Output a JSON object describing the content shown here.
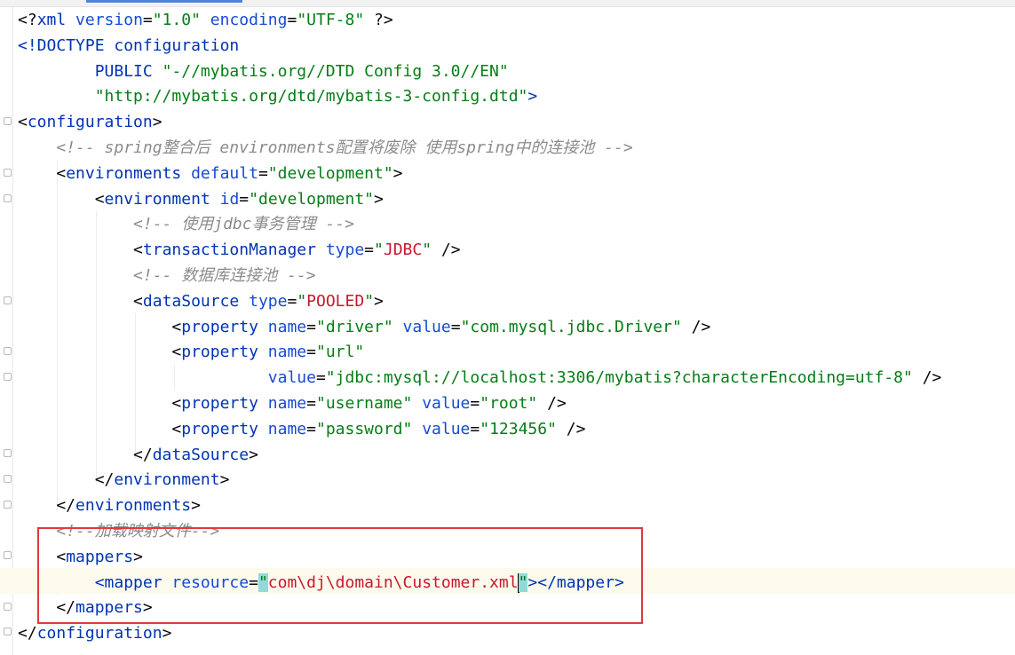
{
  "editor": {
    "lines": [
      {
        "id": "l1",
        "segments": [
          {
            "cls": "t-brk",
            "text": "<?"
          },
          {
            "cls": "t-tag",
            "text": "xml"
          },
          {
            "cls": "t-brk",
            "text": " "
          },
          {
            "cls": "t-attr",
            "text": "version"
          },
          {
            "cls": "t-brk",
            "text": "="
          },
          {
            "cls": "t-val",
            "text": "\"1.0\""
          },
          {
            "cls": "t-brk",
            "text": " "
          },
          {
            "cls": "t-attr",
            "text": "encoding"
          },
          {
            "cls": "t-brk",
            "text": "="
          },
          {
            "cls": "t-val",
            "text": "\"UTF-8\""
          },
          {
            "cls": "t-brk",
            "text": " ?>"
          }
        ]
      },
      {
        "id": "l2",
        "segments": [
          {
            "cls": "t-tag",
            "text": "<!DOCTYPE configuration"
          }
        ]
      },
      {
        "id": "l3",
        "segments": [
          {
            "cls": "t-brk",
            "text": "        "
          },
          {
            "cls": "t-tag",
            "text": "PUBLIC "
          },
          {
            "cls": "t-val",
            "text": "\"-//mybatis.org//DTD Config 3.0//EN\""
          }
        ]
      },
      {
        "id": "l4",
        "segments": [
          {
            "cls": "t-brk",
            "text": "        "
          },
          {
            "cls": "t-val",
            "text": "\"http://mybatis.org/dtd/mybatis-3-config.dtd\""
          },
          {
            "cls": "t-tag",
            "text": ">"
          }
        ]
      },
      {
        "id": "l5",
        "segments": [
          {
            "cls": "t-brk",
            "text": "<"
          },
          {
            "cls": "t-tag",
            "text": "configuration"
          },
          {
            "cls": "t-brk",
            "text": ">"
          }
        ]
      },
      {
        "id": "l6",
        "segments": [
          {
            "cls": "t-brk",
            "text": "    "
          },
          {
            "cls": "t-cmt",
            "text": "<!-- spring整合后 environments配置将废除 使用spring中的连接池 -->"
          }
        ]
      },
      {
        "id": "l7",
        "segments": [
          {
            "cls": "t-brk",
            "text": "    <"
          },
          {
            "cls": "t-tag",
            "text": "environments"
          },
          {
            "cls": "t-brk",
            "text": " "
          },
          {
            "cls": "t-attr",
            "text": "default"
          },
          {
            "cls": "t-brk",
            "text": "="
          },
          {
            "cls": "t-val",
            "text": "\"development\""
          },
          {
            "cls": "t-brk",
            "text": ">"
          }
        ]
      },
      {
        "id": "l8",
        "segments": [
          {
            "cls": "t-brk",
            "text": "        <"
          },
          {
            "cls": "t-tag",
            "text": "environment"
          },
          {
            "cls": "t-brk",
            "text": " "
          },
          {
            "cls": "t-attr",
            "text": "id"
          },
          {
            "cls": "t-brk",
            "text": "="
          },
          {
            "cls": "t-val",
            "text": "\"development\""
          },
          {
            "cls": "t-brk",
            "text": ">"
          }
        ]
      },
      {
        "id": "l9",
        "segments": [
          {
            "cls": "t-brk",
            "text": "            "
          },
          {
            "cls": "t-cmt",
            "text": "<!-- 使用jdbc事务管理 -->"
          }
        ]
      },
      {
        "id": "l10",
        "segments": [
          {
            "cls": "t-brk",
            "text": "            <"
          },
          {
            "cls": "t-tag",
            "text": "transactionManager"
          },
          {
            "cls": "t-brk",
            "text": " "
          },
          {
            "cls": "t-attr",
            "text": "type"
          },
          {
            "cls": "t-brk",
            "text": "="
          },
          {
            "cls": "t-val",
            "text": "\""
          },
          {
            "cls": "t-hl",
            "text": "JDBC"
          },
          {
            "cls": "t-val",
            "text": "\""
          },
          {
            "cls": "t-brk",
            "text": " />"
          }
        ]
      },
      {
        "id": "l11",
        "segments": [
          {
            "cls": "t-brk",
            "text": "            "
          },
          {
            "cls": "t-cmt",
            "text": "<!-- 数据库连接池 -->"
          }
        ]
      },
      {
        "id": "l12",
        "segments": [
          {
            "cls": "t-brk",
            "text": "            <"
          },
          {
            "cls": "t-tag",
            "text": "dataSource"
          },
          {
            "cls": "t-brk",
            "text": " "
          },
          {
            "cls": "t-attr",
            "text": "type"
          },
          {
            "cls": "t-brk",
            "text": "="
          },
          {
            "cls": "t-val",
            "text": "\""
          },
          {
            "cls": "t-hl",
            "text": "POOLED"
          },
          {
            "cls": "t-val",
            "text": "\""
          },
          {
            "cls": "t-brk",
            "text": ">"
          }
        ]
      },
      {
        "id": "l13",
        "segments": [
          {
            "cls": "t-brk",
            "text": "                <"
          },
          {
            "cls": "t-tag",
            "text": "property"
          },
          {
            "cls": "t-brk",
            "text": " "
          },
          {
            "cls": "t-attr",
            "text": "name"
          },
          {
            "cls": "t-brk",
            "text": "="
          },
          {
            "cls": "t-val",
            "text": "\"driver\""
          },
          {
            "cls": "t-brk",
            "text": " "
          },
          {
            "cls": "t-attr",
            "text": "value"
          },
          {
            "cls": "t-brk",
            "text": "="
          },
          {
            "cls": "t-val",
            "text": "\"com.mysql.jdbc.Driver\""
          },
          {
            "cls": "t-brk",
            "text": " />"
          }
        ]
      },
      {
        "id": "l14",
        "segments": [
          {
            "cls": "t-brk",
            "text": "                <"
          },
          {
            "cls": "t-tag",
            "text": "property"
          },
          {
            "cls": "t-brk",
            "text": " "
          },
          {
            "cls": "t-attr",
            "text": "name"
          },
          {
            "cls": "t-brk",
            "text": "="
          },
          {
            "cls": "t-val",
            "text": "\"url\""
          }
        ]
      },
      {
        "id": "l15",
        "segments": [
          {
            "cls": "t-brk",
            "text": "                          "
          },
          {
            "cls": "t-attr",
            "text": "value"
          },
          {
            "cls": "t-brk",
            "text": "="
          },
          {
            "cls": "t-val",
            "text": "\"jdbc:mysql://localhost:3306/mybatis?characterEncoding=utf-8\""
          },
          {
            "cls": "t-brk",
            "text": " />"
          }
        ]
      },
      {
        "id": "l16",
        "segments": [
          {
            "cls": "t-brk",
            "text": "                <"
          },
          {
            "cls": "t-tag",
            "text": "property"
          },
          {
            "cls": "t-brk",
            "text": " "
          },
          {
            "cls": "t-attr",
            "text": "name"
          },
          {
            "cls": "t-brk",
            "text": "="
          },
          {
            "cls": "t-val",
            "text": "\"username\""
          },
          {
            "cls": "t-brk",
            "text": " "
          },
          {
            "cls": "t-attr",
            "text": "value"
          },
          {
            "cls": "t-brk",
            "text": "="
          },
          {
            "cls": "t-val",
            "text": "\"root\""
          },
          {
            "cls": "t-brk",
            "text": " />"
          }
        ]
      },
      {
        "id": "l17",
        "segments": [
          {
            "cls": "t-brk",
            "text": "                <"
          },
          {
            "cls": "t-tag",
            "text": "property"
          },
          {
            "cls": "t-brk",
            "text": " "
          },
          {
            "cls": "t-attr",
            "text": "name"
          },
          {
            "cls": "t-brk",
            "text": "="
          },
          {
            "cls": "t-val",
            "text": "\"password\""
          },
          {
            "cls": "t-brk",
            "text": " "
          },
          {
            "cls": "t-attr",
            "text": "value"
          },
          {
            "cls": "t-brk",
            "text": "="
          },
          {
            "cls": "t-val",
            "text": "\"123456\""
          },
          {
            "cls": "t-brk",
            "text": " />"
          }
        ]
      },
      {
        "id": "l18",
        "segments": [
          {
            "cls": "t-brk",
            "text": "            </"
          },
          {
            "cls": "t-tag",
            "text": "dataSource"
          },
          {
            "cls": "t-brk",
            "text": ">"
          }
        ]
      },
      {
        "id": "l19",
        "segments": [
          {
            "cls": "t-brk",
            "text": "        </"
          },
          {
            "cls": "t-tag",
            "text": "environment"
          },
          {
            "cls": "t-brk",
            "text": ">"
          }
        ]
      },
      {
        "id": "l20",
        "segments": [
          {
            "cls": "t-brk",
            "text": "    </"
          },
          {
            "cls": "t-tag",
            "text": "environments"
          },
          {
            "cls": "t-brk",
            "text": ">"
          }
        ]
      },
      {
        "id": "l21",
        "segments": [
          {
            "cls": "t-brk",
            "text": "    "
          },
          {
            "cls": "t-cmt",
            "text": "<!--加载映射文件-->"
          }
        ]
      },
      {
        "id": "l22",
        "segments": [
          {
            "cls": "t-brk",
            "text": "    <"
          },
          {
            "cls": "t-tag",
            "text": "mappers"
          },
          {
            "cls": "t-brk",
            "text": ">"
          }
        ]
      },
      {
        "id": "l23",
        "segments": [
          {
            "cls": "t-brk",
            "text": "        "
          },
          {
            "cls": "t-tag",
            "text": "<mapper"
          },
          {
            "cls": "t-brk",
            "text": " "
          },
          {
            "cls": "t-attr",
            "text": "resource"
          },
          {
            "cls": "t-brk",
            "text": "="
          },
          {
            "cls": "t-val match",
            "text": "\""
          },
          {
            "cls": "t-hl",
            "text": "com\\dj\\domain\\Customer.xml"
          },
          {
            "cls": "cursor",
            "text": ""
          },
          {
            "cls": "t-val match",
            "text": "\""
          },
          {
            "cls": "t-tag",
            "text": "></mapper>"
          }
        ]
      },
      {
        "id": "l24",
        "segments": [
          {
            "cls": "t-brk",
            "text": "    </"
          },
          {
            "cls": "t-tag",
            "text": "mappers"
          },
          {
            "cls": "t-brk",
            "text": ">"
          }
        ]
      },
      {
        "id": "l25",
        "segments": [
          {
            "cls": "t-brk",
            "text": "</"
          },
          {
            "cls": "t-tag",
            "text": "configuration"
          },
          {
            "cls": "t-brk",
            "text": ">"
          }
        ]
      }
    ]
  }
}
